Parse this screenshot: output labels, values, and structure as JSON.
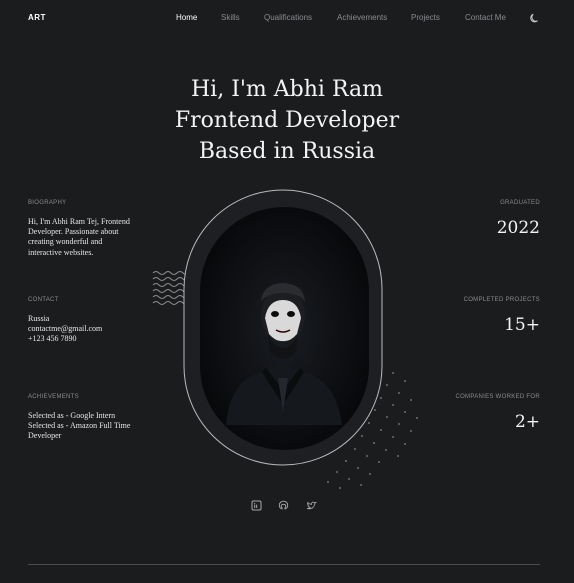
{
  "brand": {
    "logo": "ART"
  },
  "nav": {
    "items": [
      {
        "label": "Home",
        "active": true
      },
      {
        "label": "Skills",
        "active": false
      },
      {
        "label": "Qualifications",
        "active": false
      },
      {
        "label": "Achievements",
        "active": false
      },
      {
        "label": "Projects",
        "active": false
      },
      {
        "label": "Contact Me",
        "active": false
      }
    ],
    "theme_icon": "moon-icon"
  },
  "hero": {
    "lines": [
      "Hi, I'm Abhi Ram",
      "Frontend Developer",
      "Based in Russia"
    ]
  },
  "left": {
    "biography": {
      "label": "BIOGRAPHY",
      "lines": [
        "Hi, I'm Abhi Ram Tej, Frontend",
        "Developer. Passionate about",
        "creating wonderful and",
        "interactive websites."
      ]
    },
    "contact": {
      "label": "CONTACT",
      "lines": [
        "Russia",
        "contactme@gmail.com",
        "+123 456 7890"
      ]
    },
    "achievements": {
      "label": "ACHIEVEMENTS",
      "lines": [
        "Selected as - Google Intern",
        "Selected as - Amazon Full Time",
        "Developer"
      ]
    }
  },
  "right": {
    "graduated": {
      "label": "GRADUATED",
      "value": "2022"
    },
    "projects": {
      "label": "COMPLETED PROJECTS",
      "value": "15+"
    },
    "companies": {
      "label": "COMPANIES WORKED FOR",
      "value": "2+"
    }
  },
  "socials": [
    "linkedin-icon",
    "github-icon",
    "twitter-icon"
  ],
  "colors": {
    "background": "#1b1c1e",
    "text": "#f0f0f0",
    "muted": "#8a8b8f",
    "frame": "#b9babd"
  }
}
